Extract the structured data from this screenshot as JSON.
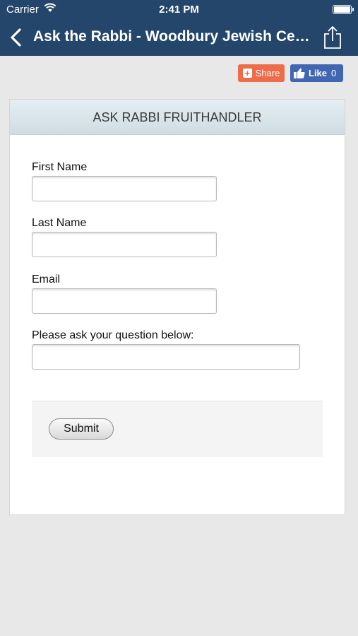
{
  "status_bar": {
    "carrier": "Carrier",
    "time": "2:41 PM"
  },
  "nav": {
    "title": "Ask the Rabbi - Woodbury Jewish Center"
  },
  "social": {
    "share_label": "Share",
    "share_glyph": "+",
    "like_label": "Like",
    "like_count": "0"
  },
  "form": {
    "header": "ASK RABBI FRUITHANDLER",
    "fields": [
      {
        "label": "First Name",
        "value": ""
      },
      {
        "label": "Last Name",
        "value": ""
      },
      {
        "label": "Email",
        "value": ""
      },
      {
        "label": "Please ask your question below:",
        "value": ""
      }
    ],
    "submit_label": "Submit"
  },
  "colors": {
    "nav_bg": "#23466a",
    "share_bg": "#ef6c4a",
    "like_bg": "#4267b2",
    "page_bg": "#e8e8e8"
  }
}
